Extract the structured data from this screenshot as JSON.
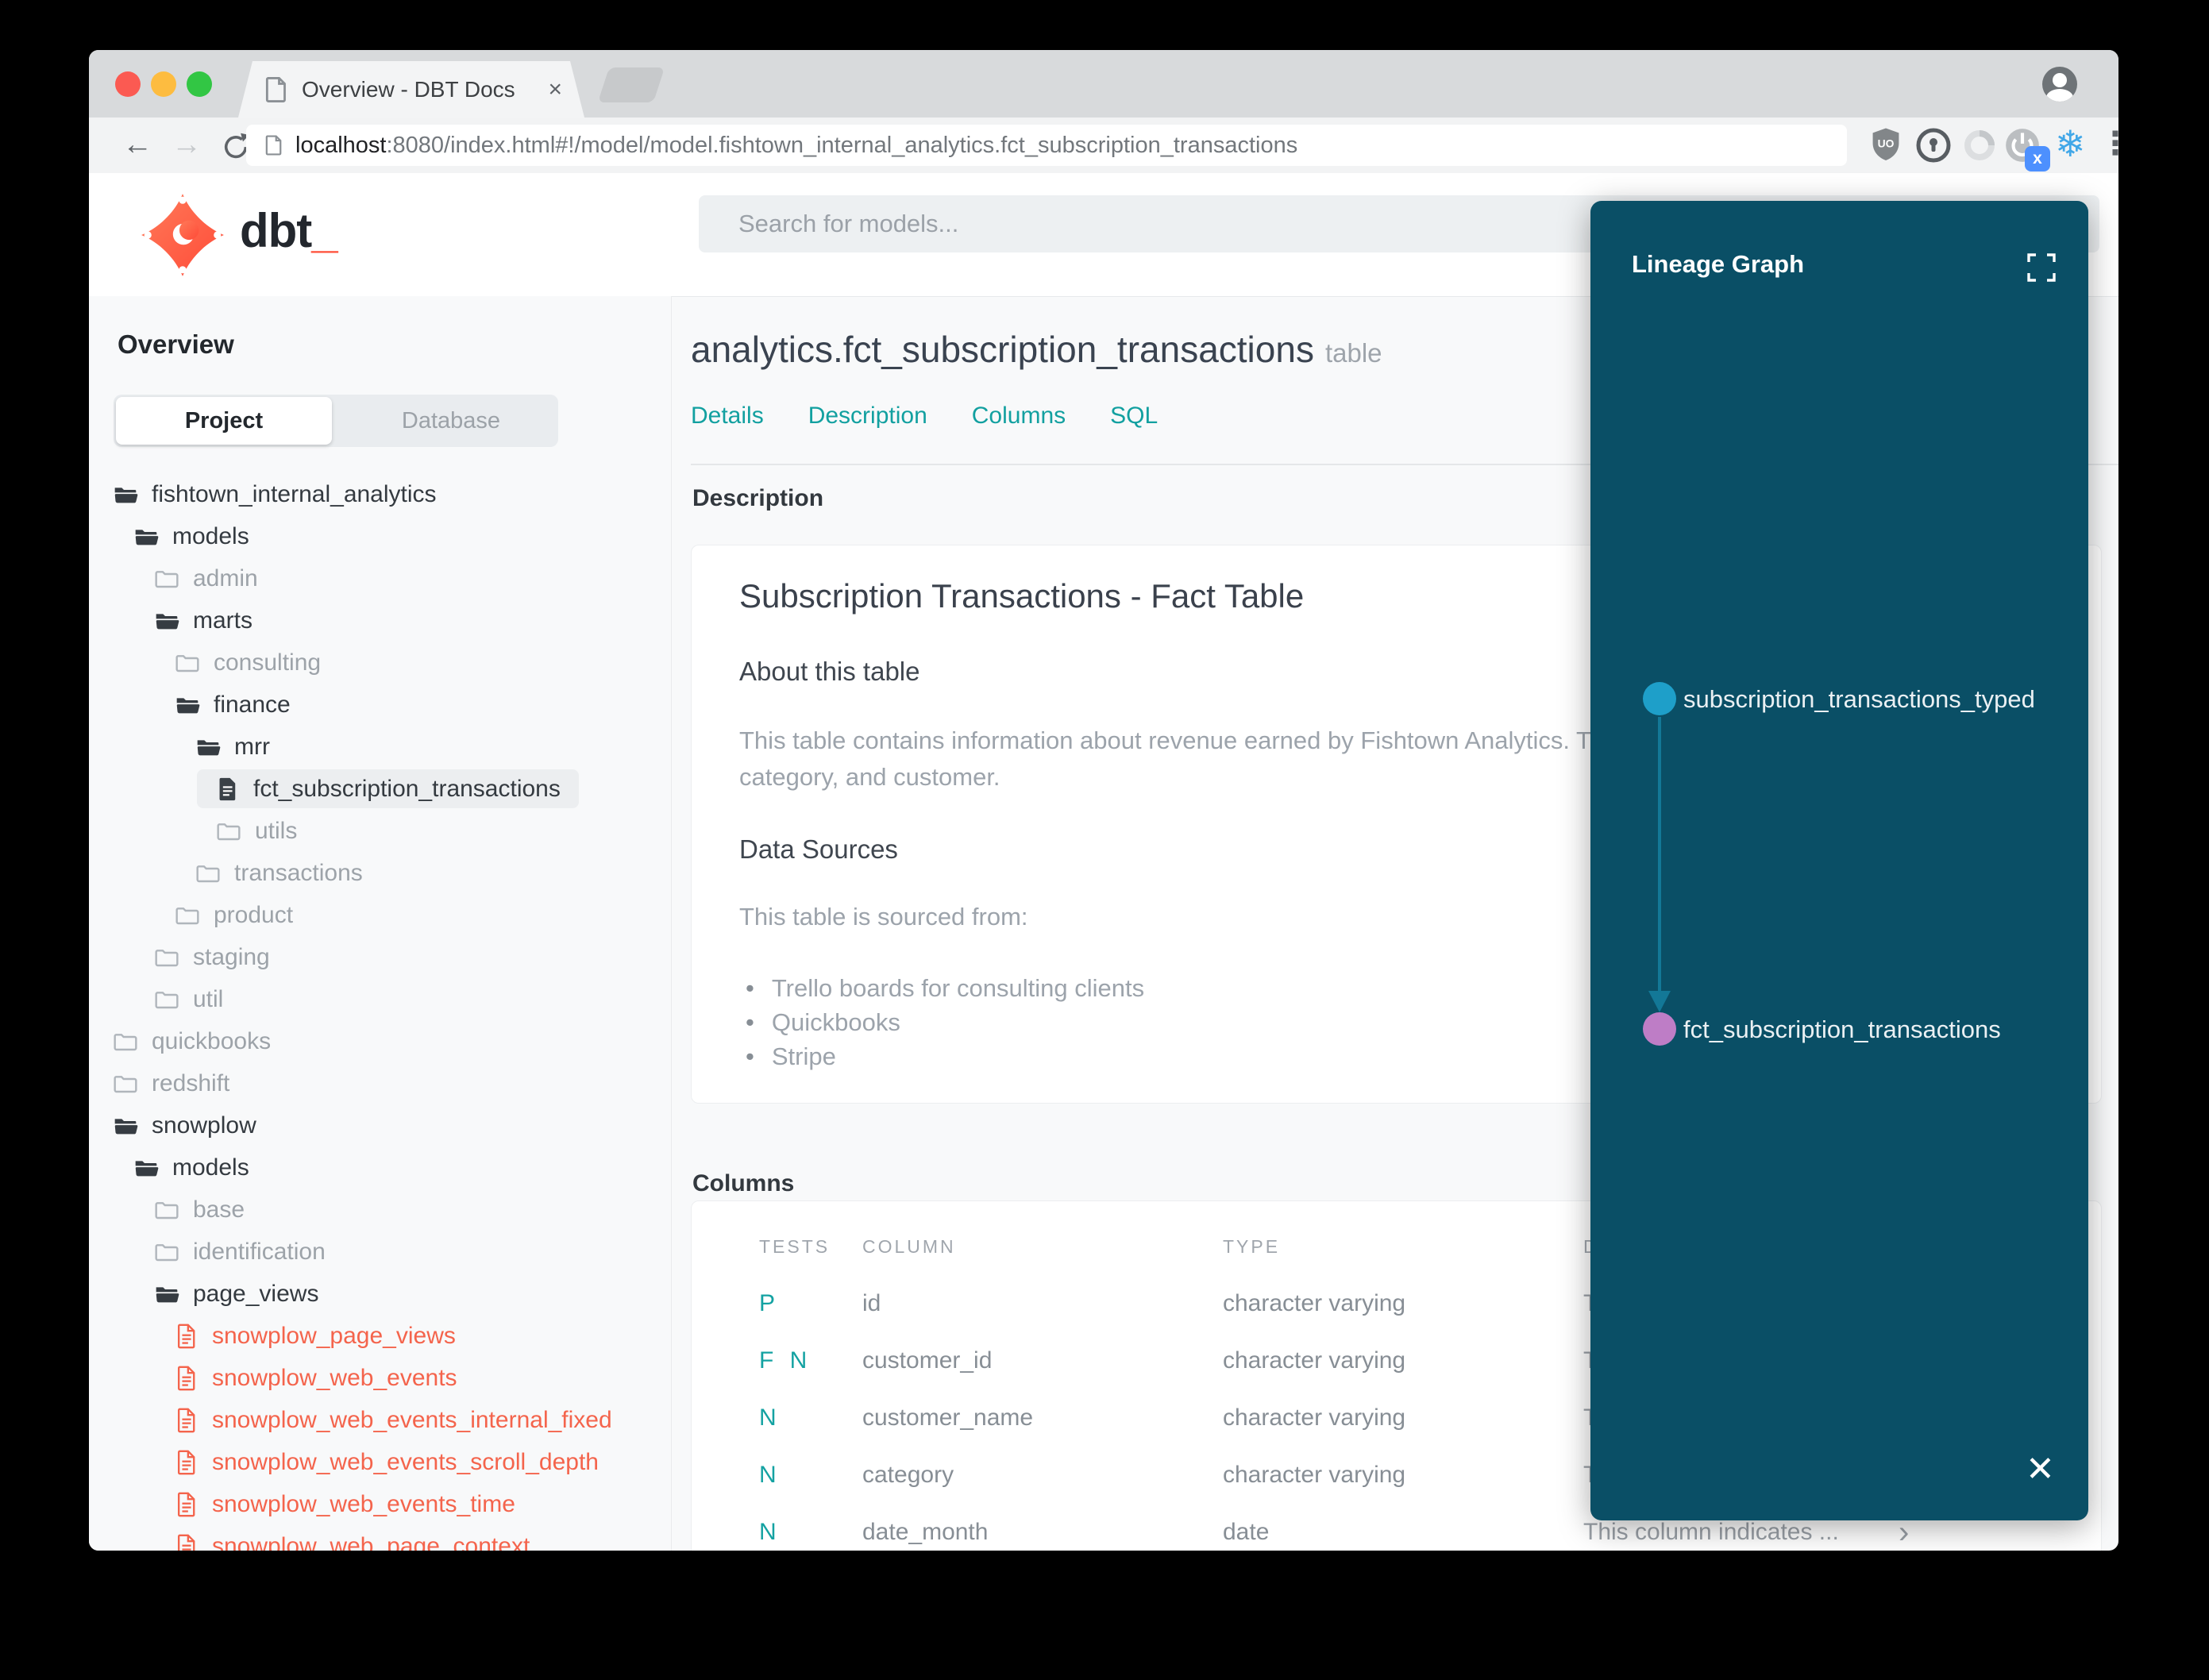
{
  "browser": {
    "tab_title": "Overview - DBT Docs",
    "url_host": "localhost",
    "url_rest": ":8080/index.html#!/model/model.fishtown_internal_analytics.fct_subscription_transactions",
    "extension_icons": [
      "ublock-shield-icon",
      "onepassword-icon",
      "swirl-extension-icon",
      "power-extension-icon",
      "snowflake-extension-icon"
    ],
    "shield_text": "UO",
    "power_badge": "x"
  },
  "glyphs": {
    "close": "×",
    "back": "←",
    "forward": "→",
    "snowflake": "❄",
    "dots": "⋮",
    "chevron": "›",
    "panel_close": "✕",
    "bullet": "•"
  },
  "header": {
    "logo_text": "dbt",
    "logo_underscore": "_",
    "search_placeholder": "Search for models..."
  },
  "sidebar": {
    "section_title": "Overview",
    "tabs": {
      "project": "Project",
      "database": "Database"
    },
    "tree": [
      {
        "label": "fishtown_internal_analytics",
        "level": 0,
        "icon": "folder-open",
        "tone": "dark"
      },
      {
        "label": "models",
        "level": 1,
        "icon": "folder-open",
        "tone": "dark"
      },
      {
        "label": "admin",
        "level": 2,
        "icon": "folder-closed",
        "tone": "gray"
      },
      {
        "label": "marts",
        "level": 2,
        "icon": "folder-open",
        "tone": "dark"
      },
      {
        "label": "consulting",
        "level": 3,
        "icon": "folder-closed",
        "tone": "gray"
      },
      {
        "label": "finance",
        "level": 3,
        "icon": "folder-open",
        "tone": "dark"
      },
      {
        "label": "mrr",
        "level": 4,
        "icon": "folder-open",
        "tone": "dark"
      },
      {
        "label": "fct_subscription_transactions",
        "level": 5,
        "icon": "file-dark",
        "tone": "dark",
        "selected": true
      },
      {
        "label": "utils",
        "level": 5,
        "icon": "folder-closed",
        "tone": "gray"
      },
      {
        "label": "transactions",
        "level": 4,
        "icon": "folder-closed",
        "tone": "gray"
      },
      {
        "label": "product",
        "level": 3,
        "icon": "folder-closed",
        "tone": "gray"
      },
      {
        "label": "staging",
        "level": 2,
        "icon": "folder-closed",
        "tone": "gray"
      },
      {
        "label": "util",
        "level": 2,
        "icon": "folder-closed",
        "tone": "gray"
      },
      {
        "label": "quickbooks",
        "level": 0,
        "icon": "folder-closed",
        "tone": "gray"
      },
      {
        "label": "redshift",
        "level": 0,
        "icon": "folder-closed",
        "tone": "gray"
      },
      {
        "label": "snowplow",
        "level": 0,
        "icon": "folder-open",
        "tone": "dark"
      },
      {
        "label": "models",
        "level": 1,
        "icon": "folder-open",
        "tone": "dark"
      },
      {
        "label": "base",
        "level": 2,
        "icon": "folder-closed",
        "tone": "gray"
      },
      {
        "label": "identification",
        "level": 2,
        "icon": "folder-closed",
        "tone": "gray"
      },
      {
        "label": "page_views",
        "level": 2,
        "icon": "folder-open",
        "tone": "dark"
      },
      {
        "label": "snowplow_page_views",
        "level": 3,
        "icon": "file-red",
        "tone": "red"
      },
      {
        "label": "snowplow_web_events",
        "level": 3,
        "icon": "file-red",
        "tone": "red"
      },
      {
        "label": "snowplow_web_events_internal_fixed",
        "level": 3,
        "icon": "file-red",
        "tone": "red"
      },
      {
        "label": "snowplow_web_events_scroll_depth",
        "level": 3,
        "icon": "file-red",
        "tone": "red"
      },
      {
        "label": "snowplow_web_events_time",
        "level": 3,
        "icon": "file-red",
        "tone": "red"
      },
      {
        "label": "snowplow_web_page_context",
        "level": 3,
        "icon": "file-red",
        "tone": "red"
      }
    ]
  },
  "main": {
    "title": "analytics.fct_subscription_transactions",
    "title_suffix": "table",
    "nav_tabs": [
      "Details",
      "Description",
      "Columns",
      "SQL"
    ],
    "description_section_label": "Description",
    "description_card": {
      "heading": "Subscription Transactions - Fact Table",
      "about_heading": "About this table",
      "about_line1": "This table contains information about revenue earned by Fishtown Analytics. Trans",
      "about_line2": "category, and customer.",
      "sources_heading": "Data Sources",
      "sources_intro": "This table is sourced from:",
      "sources": [
        "Trello boards for consulting clients",
        "Quickbooks",
        "Stripe"
      ]
    },
    "columns_section_label": "Columns",
    "table": {
      "headers": [
        "TESTS",
        "COLUMN",
        "TYPE",
        "D"
      ],
      "rows": [
        {
          "tests": "P",
          "column": "id",
          "type": "character varying",
          "desc": "T"
        },
        {
          "tests": "F N",
          "column": "customer_id",
          "type": "character varying",
          "desc": "T"
        },
        {
          "tests": "N",
          "column": "customer_name",
          "type": "character varying",
          "desc": "T"
        },
        {
          "tests": "N",
          "column": "category",
          "type": "character varying",
          "desc": "T"
        },
        {
          "tests": "N",
          "column": "date_month",
          "type": "date",
          "desc": "This column indicates ...",
          "chevron": true
        }
      ]
    }
  },
  "lineage": {
    "title": "Lineage Graph",
    "nodes": [
      {
        "label": "subscription_transactions_typed",
        "color": "#1E9FC9"
      },
      {
        "label": "fct_subscription_transactions",
        "color": "#BE7DC6"
      }
    ],
    "edge_color": "#137897"
  },
  "colors": {
    "accent_teal": "#12A0A0",
    "dbt_orange": "#FF4F38",
    "file_red": "#F4644C",
    "panel_bg": "#0A4F66"
  }
}
